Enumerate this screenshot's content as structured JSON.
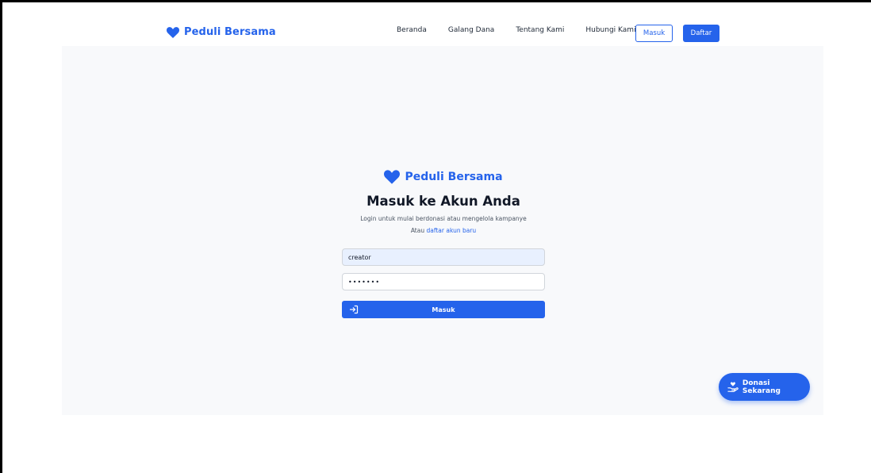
{
  "navbar": {
    "brand": "Peduli Bersama",
    "links": [
      "Beranda",
      "Galang Dana",
      "Tentang Kami",
      "Hubungi Kami"
    ],
    "login_button": "Masuk",
    "register_button": "Daftar"
  },
  "login": {
    "brand": "Peduli Bersama",
    "title": "Masuk ke Akun Anda",
    "subtitle": "Login untuk mulai berdonasi atau mengelola kampanye",
    "alt_prefix": "Atau",
    "alt_link": "daftar akun baru",
    "username_value": "creator",
    "password_value": "•••••••",
    "submit_label": "Masuk"
  },
  "fab": {
    "label": "Donasi Sekarang",
    "icon": "hand-heart-icon"
  },
  "colors": {
    "primary": "#2563eb",
    "background": "#f8f9fb"
  }
}
